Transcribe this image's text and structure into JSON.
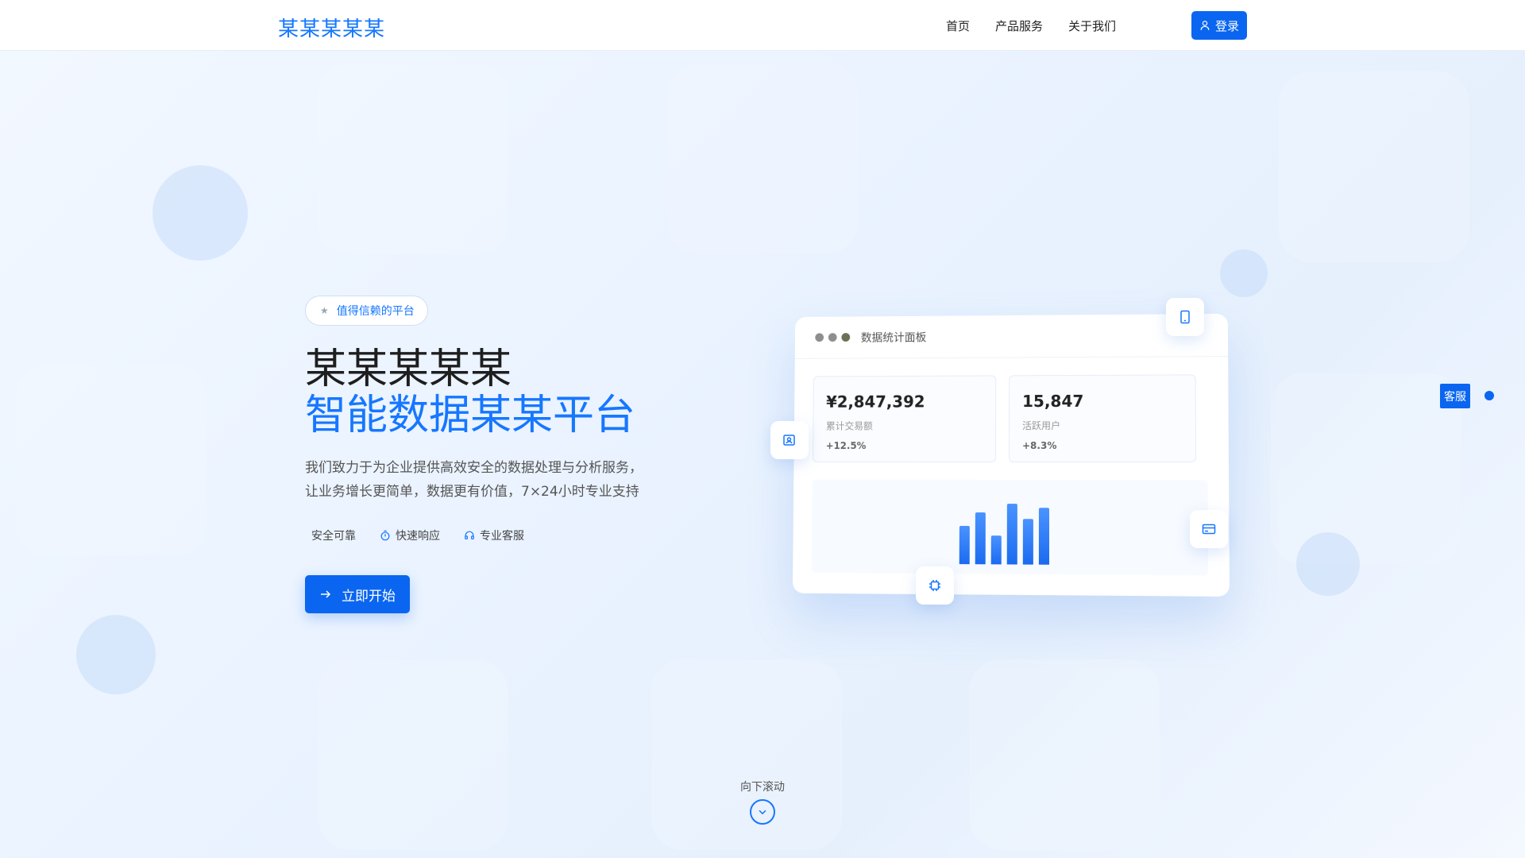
{
  "header": {
    "logo": "某某某某某",
    "nav": [
      "首页",
      "产品服务",
      "关于我们"
    ],
    "login_label": "登录"
  },
  "hero": {
    "badge": "值得信赖的平台",
    "title_line1": "某某某某某",
    "title_line2": "智能数据某某平台",
    "desc_line1": "我们致力于为企业提供高效安全的数据处理与分析服务，",
    "desc_line2": "让业务增长更简单，数据更有价值，7×24小时专业支持",
    "features": [
      "安全可靠",
      "快速响应",
      "专业客服"
    ],
    "cta_label": "立即开始"
  },
  "dashboard": {
    "title": "数据统计面板",
    "stats": [
      {
        "value": "¥2,847,392",
        "label": "累计交易额",
        "change": "+12.5%"
      },
      {
        "value": "15,847",
        "label": "活跃用户",
        "change": "+8.3%"
      }
    ],
    "bars": [
      0.56,
      0.76,
      0.42,
      0.88,
      0.66,
      0.82
    ]
  },
  "side": {
    "tag": "客服"
  },
  "scroll": {
    "label": "向下滚动"
  },
  "colors": {
    "primary": "#0a66f0",
    "accent": "#1677ff"
  },
  "icons": [
    "user-icon",
    "star-icon",
    "shield-icon",
    "timer-icon",
    "headset-icon",
    "arrow-right-icon",
    "tablet-icon",
    "id-card-icon",
    "credit-card-icon",
    "chip-icon",
    "chevron-down-icon"
  ]
}
